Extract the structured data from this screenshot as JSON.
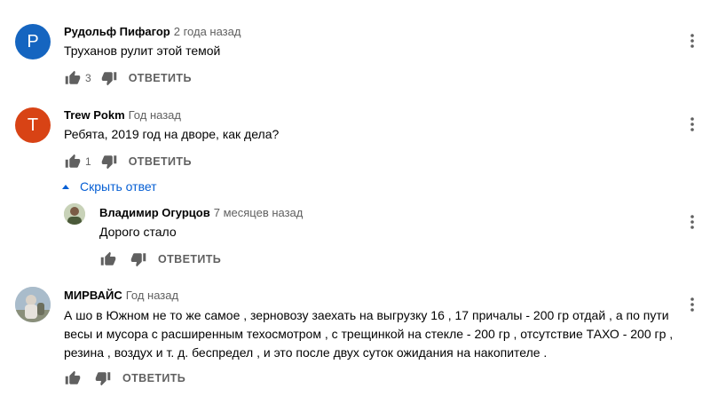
{
  "comments": [
    {
      "author": "Рудольф Пифагор",
      "time": "2 года назад",
      "text": "Труханов рулит этой темой",
      "likes": "3",
      "reply_label": "ОТВЕТИТЬ",
      "avatar_letter": "P",
      "avatar_color": "#1565c0"
    },
    {
      "author": "Trew Pokm",
      "time": "Год назад",
      "text": "Ребята, 2019 год на дворе, как дела?",
      "likes": "1",
      "reply_label": "ОТВЕТИТЬ",
      "avatar_letter": "T",
      "avatar_color": "#d84315"
    }
  ],
  "hide_replies_label": "Скрыть ответ",
  "reply": {
    "author": "Владимир Огурцов",
    "time": "7 месяцев назад",
    "text": "Дорого стало",
    "reply_label": "ОТВЕТИТЬ"
  },
  "comment3": {
    "author": "МИРВАЙС",
    "time": "Год назад",
    "text_lines": [
      "А шо в Южном не то же самое , зерновозу заехать на выгрузку 16 , 17 причалы - 200 гр отдай , а по пути",
      "весы и мусора с расширенным техосмотром , с трещинкой на стекле - 200 гр , отсутствие ТАХО - 200 гр ,",
      "резина , воздух и т. д.  беспредел , и это после двух суток ожидания на накопителе ."
    ],
    "reply_label": "ОТВЕТИТЬ"
  },
  "colors": {
    "link": "#065fd4",
    "secondary_text": "#606060",
    "icon": "#606060"
  }
}
